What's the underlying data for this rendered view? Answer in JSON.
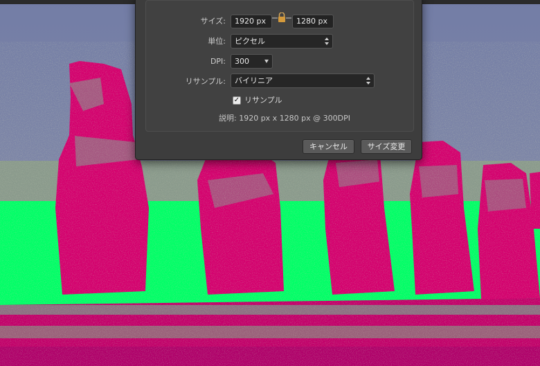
{
  "dialog": {
    "size_label": "サイズ:",
    "width_value": "1920 px",
    "height_value": "1280 px",
    "unit_label": "単位:",
    "unit_value": "ピクセル",
    "dpi_label": "DPI:",
    "dpi_value": "300",
    "resample_label": "リサンプル:",
    "resample_value": "バイリニア",
    "resample_checkbox_label": "リサンプル",
    "resample_checked": "✓",
    "description": "説明: 1920 px x 1280 px @ 300DPI",
    "cancel_label": "キャンセル",
    "resize_label": "サイズ変更"
  },
  "colors": {
    "sky": "#7b84a8",
    "ground": "#00ff66",
    "statue": "#d4006e",
    "dialog_bg": "#3d3d3d"
  },
  "icons": {
    "lock": "lock-icon",
    "stepper": "up-down-arrows-icon",
    "dropdown": "triangle-down-icon"
  }
}
